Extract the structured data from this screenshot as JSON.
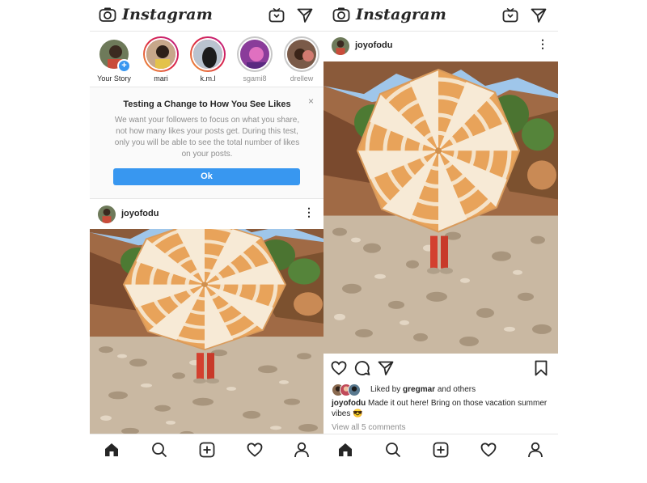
{
  "app": {
    "name": "Instagram"
  },
  "stories": [
    {
      "name": "Your Story",
      "state": "own"
    },
    {
      "name": "mari",
      "state": "active"
    },
    {
      "name": "k.m.l",
      "state": "active"
    },
    {
      "name": "sgami8",
      "state": "seen"
    },
    {
      "name": "drellew",
      "state": "seen"
    }
  ],
  "notice": {
    "title": "Testing a Change to How You See Likes",
    "body": "We want your followers to focus on what you share, not how many likes your posts get. During this test, only you will be able to see the total number of likes on your posts.",
    "ok_label": "Ok",
    "close_symbol": "×"
  },
  "post": {
    "username": "joyofodu",
    "liked_by_prefix": "Liked by ",
    "liked_by_user": "gregmar",
    "liked_by_suffix": " and others",
    "caption_user": "joyofodu",
    "caption_text": "Made it out here! Bring on those vacation summer vibes",
    "caption_emoji": "😎",
    "view_comments": "View all 5 comments"
  },
  "nav": [
    "home-icon",
    "search-icon",
    "new-post-icon",
    "activity-heart-icon",
    "profile-icon"
  ],
  "colors": {
    "accent_blue": "#3897f0",
    "text": "#262626",
    "secondary": "#8e8e8e",
    "umbrella_stripe": "#e8a35a",
    "sky": "#9fc6ea"
  }
}
